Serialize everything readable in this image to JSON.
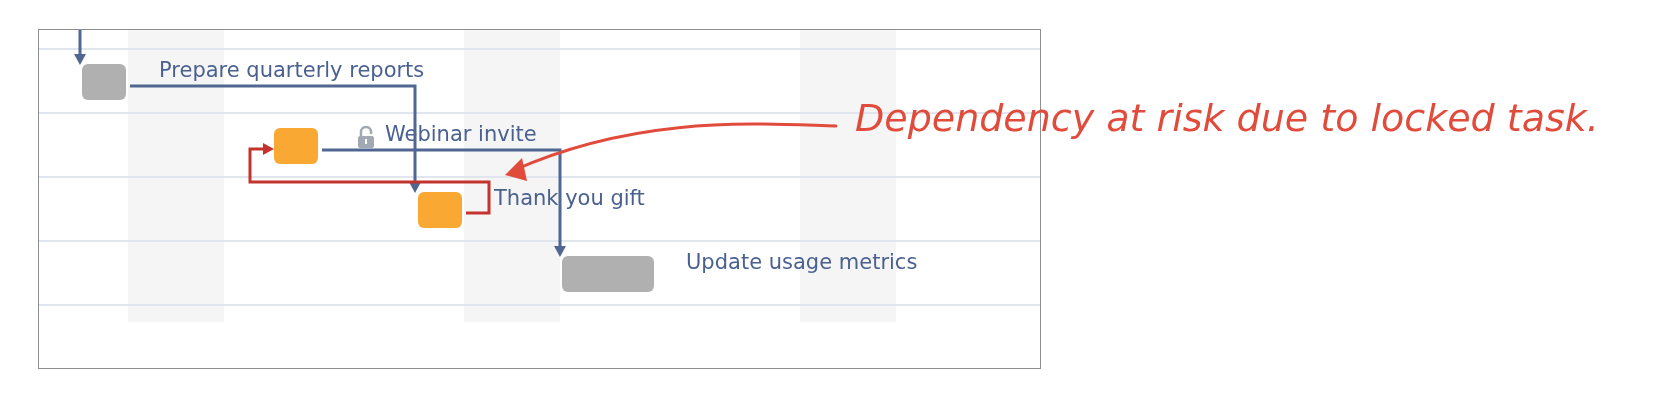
{
  "tasks": [
    {
      "label": "Prepare quarterly reports",
      "color": "#b0b0b0",
      "locked": false
    },
    {
      "label": "Webinar invite",
      "color": "#f9a833",
      "locked": true
    },
    {
      "label": "Thank you gift",
      "color": "#f9a833",
      "locked": false
    },
    {
      "label": "Update usage metrics",
      "color": "#b0b0b0",
      "locked": false
    }
  ],
  "dependencies": [
    {
      "at_risk": false
    },
    {
      "at_risk": false
    },
    {
      "at_risk": false
    },
    {
      "at_risk": true
    }
  ],
  "annotation": {
    "text": "Dependency at risk due to locked task."
  }
}
